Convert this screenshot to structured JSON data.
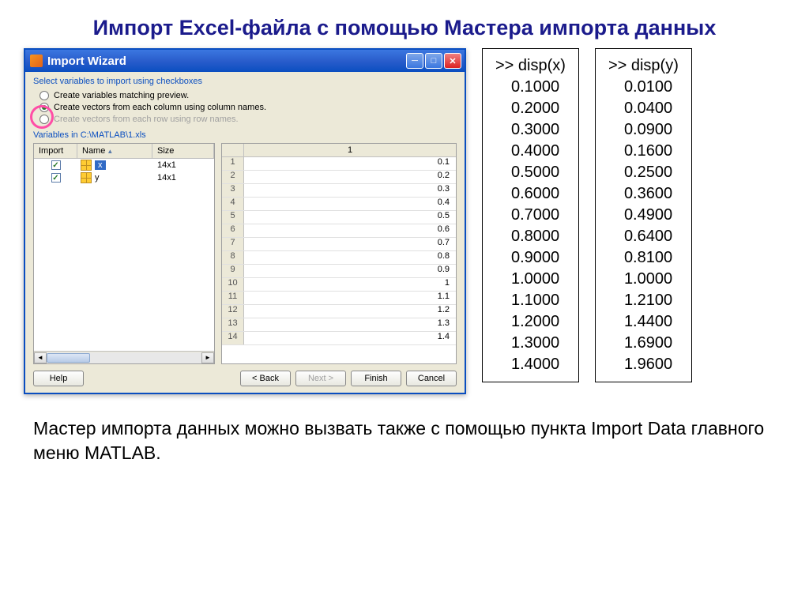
{
  "page_title": "Импорт Excel-файла с помощью Мастера импорта данных",
  "window": {
    "title": "Import Wizard",
    "instruction": "Select variables to import using checkboxes",
    "radios": {
      "r1": "Create variables matching preview.",
      "r2": "Create vectors from each column using column names.",
      "r3": "Create vectors from each row using row names."
    },
    "path_label": "Variables in C:\\MATLAB\\1.xls",
    "left_headers": {
      "import": "Import",
      "name": "Name",
      "size": "Size"
    },
    "vars": [
      {
        "name": "x",
        "size": "14x1"
      },
      {
        "name": "y",
        "size": "14x1"
      }
    ],
    "grid_col_header": "1",
    "grid_values": [
      "0.1",
      "0.2",
      "0.3",
      "0.4",
      "0.5",
      "0.6",
      "0.7",
      "0.8",
      "0.9",
      "1",
      "1.1",
      "1.2",
      "1.3",
      "1.4"
    ],
    "buttons": {
      "help": "Help",
      "back": "< Back",
      "next": "Next >",
      "finish": "Finish",
      "cancel": "Cancel"
    }
  },
  "disp_x": {
    "cmd": ">> disp(x)",
    "vals": [
      "0.1000",
      "0.2000",
      "0.3000",
      "0.4000",
      "0.5000",
      "0.6000",
      "0.7000",
      "0.8000",
      "0.9000",
      "1.0000",
      "1.1000",
      "1.2000",
      "1.3000",
      "1.4000"
    ]
  },
  "disp_y": {
    "cmd": ">> disp(y)",
    "vals": [
      "0.0100",
      "0.0400",
      "0.0900",
      "0.1600",
      "0.2500",
      "0.3600",
      "0.4900",
      "0.6400",
      "0.8100",
      "1.0000",
      "1.2100",
      "1.4400",
      "1.6900",
      "1.9600"
    ]
  },
  "footer": "Мастер импорта данных можно вызвать также с помощью пункта Import Data главного меню MATLAB."
}
